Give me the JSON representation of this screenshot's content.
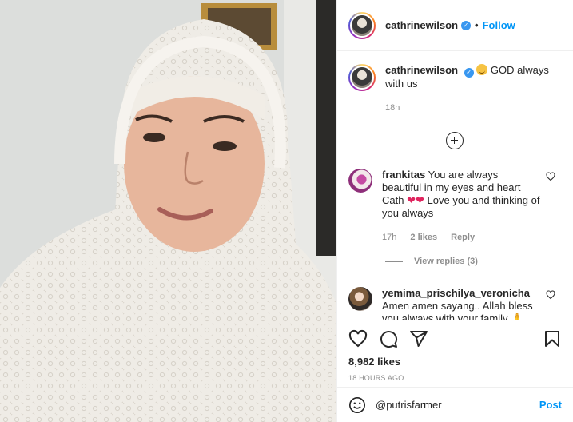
{
  "post": {
    "author": "cathrinewilson",
    "follow_label": "Follow",
    "dot": "•",
    "caption_text": "GOD always with us",
    "caption_time": "18h",
    "likes": "8,982 likes",
    "posted_ago": "18 HOURS AGO"
  },
  "comments": [
    {
      "user": "frankitas",
      "text_a": "You are always beautiful in my eyes and heart Cath",
      "hearts": "❤❤",
      "text_b": "Love you and thinking of you always",
      "time": "17h",
      "likes": "2 likes",
      "reply_label": "Reply",
      "view_replies": "View replies (3)"
    },
    {
      "user": "yemima_prischilya_veronicha",
      "text": "Amen amen sayang.. Allah bless you always with your family 🙏"
    }
  ],
  "composer": {
    "value": "@putrisfarmer",
    "post_label": "Post"
  },
  "icons": [
    "emoji-smile-icon",
    "heart-icon",
    "comment-icon",
    "share-icon",
    "bookmark-icon",
    "add-circle-icon",
    "verified-badge-icon"
  ],
  "colors": {
    "link_blue": "#0095f6",
    "verified_blue": "#3897f0",
    "muted": "#8e8e8e"
  }
}
